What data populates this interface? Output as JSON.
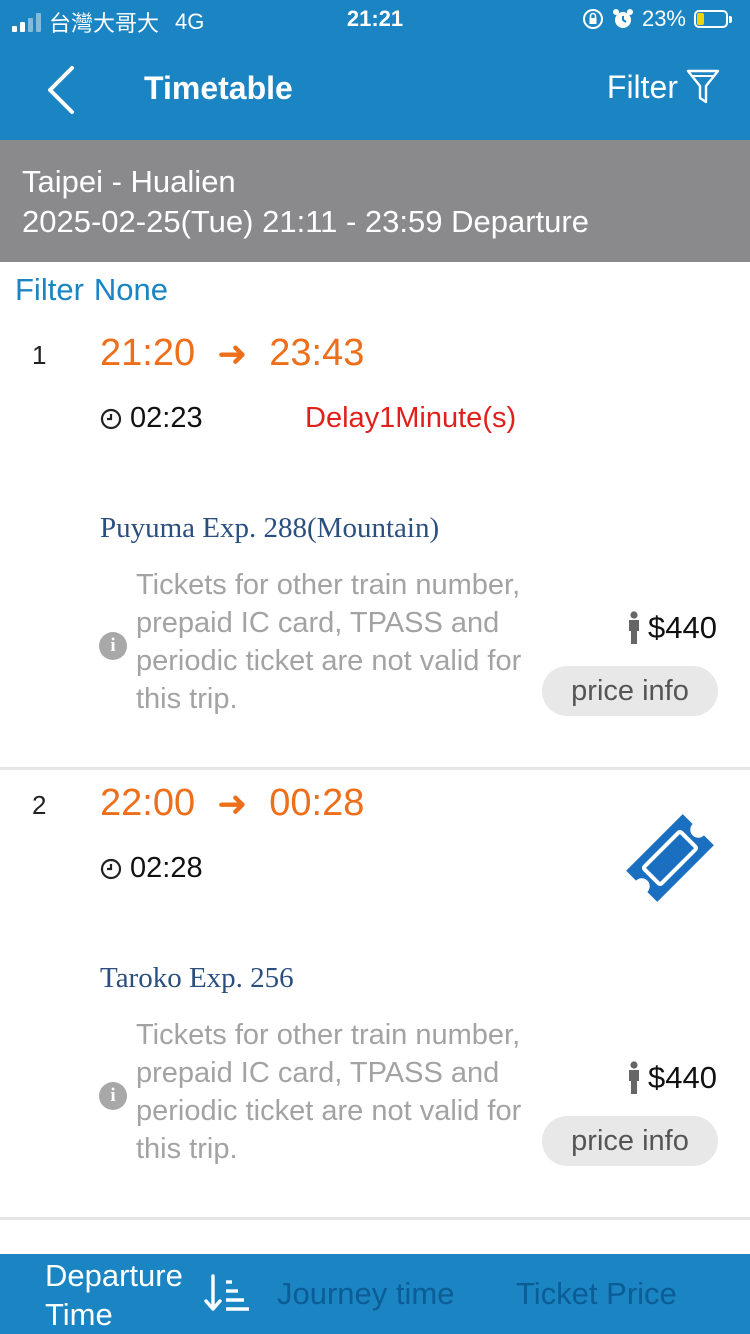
{
  "status_bar": {
    "carrier": "台灣大哥大",
    "network": "4G",
    "time": "21:21",
    "battery_percent": "23%",
    "battery_level": 0.23,
    "icons": [
      "orientation-lock-icon",
      "alarm-icon"
    ]
  },
  "nav": {
    "back_icon": "chevron-left-icon",
    "title": "Timetable",
    "filter_label": "Filter",
    "filter_icon": "funnel-icon"
  },
  "route": {
    "stations": "Taipei - Hualien",
    "datetime": "2025-02-25(Tue) 21:11 - 23:59 Departure"
  },
  "filter": {
    "label": "Filter",
    "value": "None"
  },
  "trains": [
    {
      "index": "1",
      "depart": "21:20",
      "arrow": "➜",
      "arrive": "23:43",
      "duration": "02:23",
      "delay": "Delay1Minute(s)",
      "name": "Puyuma Exp. 288(Mountain)",
      "notice": "Tickets for other train number, prepaid IC card, TPASS and periodic ticket are not valid for this trip.",
      "price": "$440",
      "price_button": "price info",
      "ticket_icon": false
    },
    {
      "index": "2",
      "depart": "22:00",
      "arrow": "➜",
      "arrive": "00:28",
      "duration": "02:28",
      "delay": "",
      "name": "Taroko Exp. 256",
      "notice": "Tickets for other train number, prepaid IC card, TPASS and periodic ticket are not valid for this trip.",
      "price": "$440",
      "price_button": "price info",
      "ticket_icon": true
    }
  ],
  "sort_bar": {
    "departure_time": "Departure Time",
    "journey_time": "Journey time",
    "ticket_price": "Ticket Price",
    "active": "departure_time",
    "sort_icon": "sort-descending-icon"
  },
  "colors": {
    "primary": "#1b84c3",
    "banner": "#8a8a8c",
    "time_orange": "#ee6f1b",
    "delay_red": "#e0201b",
    "train_name": "#2b4f7e"
  }
}
